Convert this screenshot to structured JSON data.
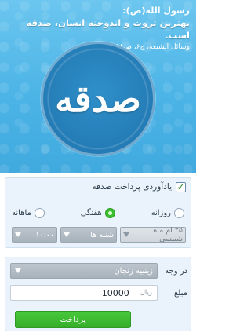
{
  "hero": {
    "author": "رسول الله(ص):",
    "quote": "بهترین ثروت و اندوخته انسان، صدقه است.",
    "source": "وسائل الشیعه، ج۶، ص۲۵۸",
    "medallion_word": "صدقه"
  },
  "reminder": {
    "checked": true,
    "title": "یادآوردی پرداخت صدقه",
    "frequency_options": [
      "روزانه",
      "هفتگی",
      "ماهانه"
    ],
    "selected_frequency": "هفتگی",
    "date_select": "۲۵ ام ماه شمسی",
    "weekday_select": "شنبه ها",
    "time_select": "۱۰:۰۰"
  },
  "payment": {
    "target_label": "در وجه",
    "target_value": "زینبیه زنجان",
    "amount_label": "مبلغ",
    "amount_value": "10000",
    "currency": "ریال",
    "pay_button": "پرداخت"
  },
  "colors": {
    "hero_blue": "#4cb4e6",
    "medallion_blue": "#247bb5",
    "accent_green": "#3cbf2f"
  }
}
